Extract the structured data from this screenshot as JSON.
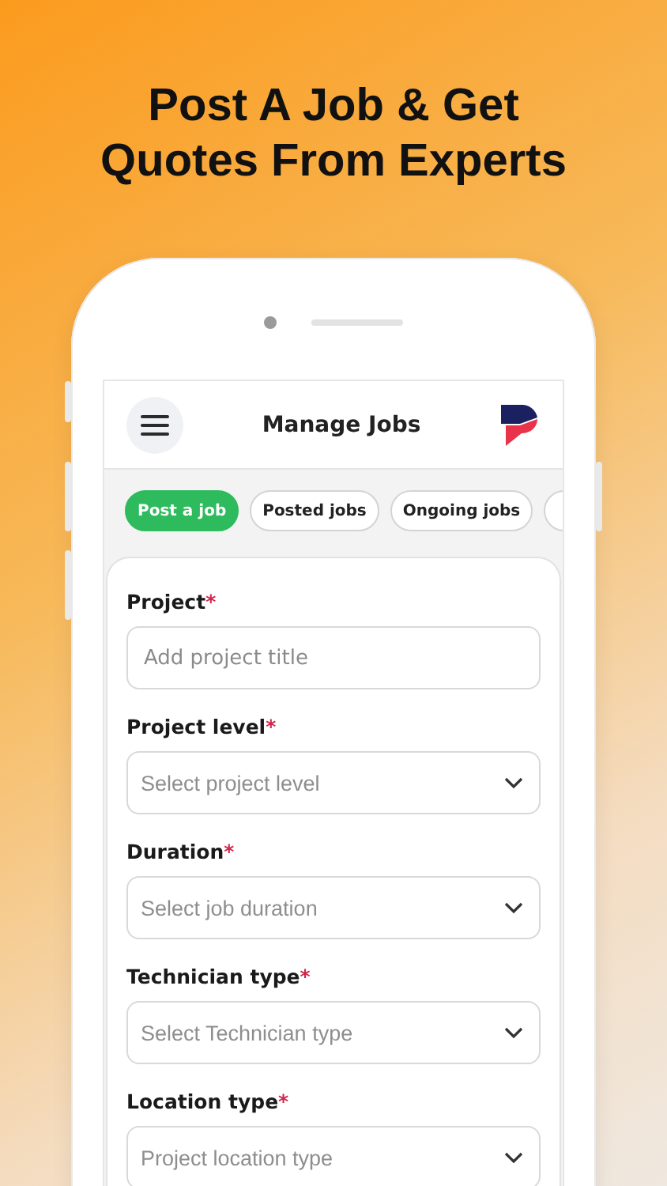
{
  "headline": [
    "Post A Job & Get",
    "Quotes From Experts"
  ],
  "app_bar": {
    "title": "Manage Jobs"
  },
  "tabs": [
    {
      "label": "Post a job",
      "selected": true
    },
    {
      "label": "Posted jobs",
      "selected": false
    },
    {
      "label": "Ongoing jobs",
      "selected": false
    }
  ],
  "more_tabs_clipped": true,
  "form_fields": [
    {
      "kind": "text",
      "label": "Project",
      "required_mark": "*",
      "placeholder": "Add project title"
    },
    {
      "kind": "select",
      "label": "Project level",
      "required_mark": "*",
      "placeholder": "Select project level"
    },
    {
      "kind": "select",
      "label": "Duration",
      "required_mark": "*",
      "placeholder": "Select job duration"
    },
    {
      "kind": "select",
      "label": "Technician type",
      "required_mark": "*",
      "placeholder": "Select Technician type"
    },
    {
      "kind": "select",
      "label": "Location type",
      "required_mark": "*",
      "placeholder": "Project location type"
    }
  ]
}
